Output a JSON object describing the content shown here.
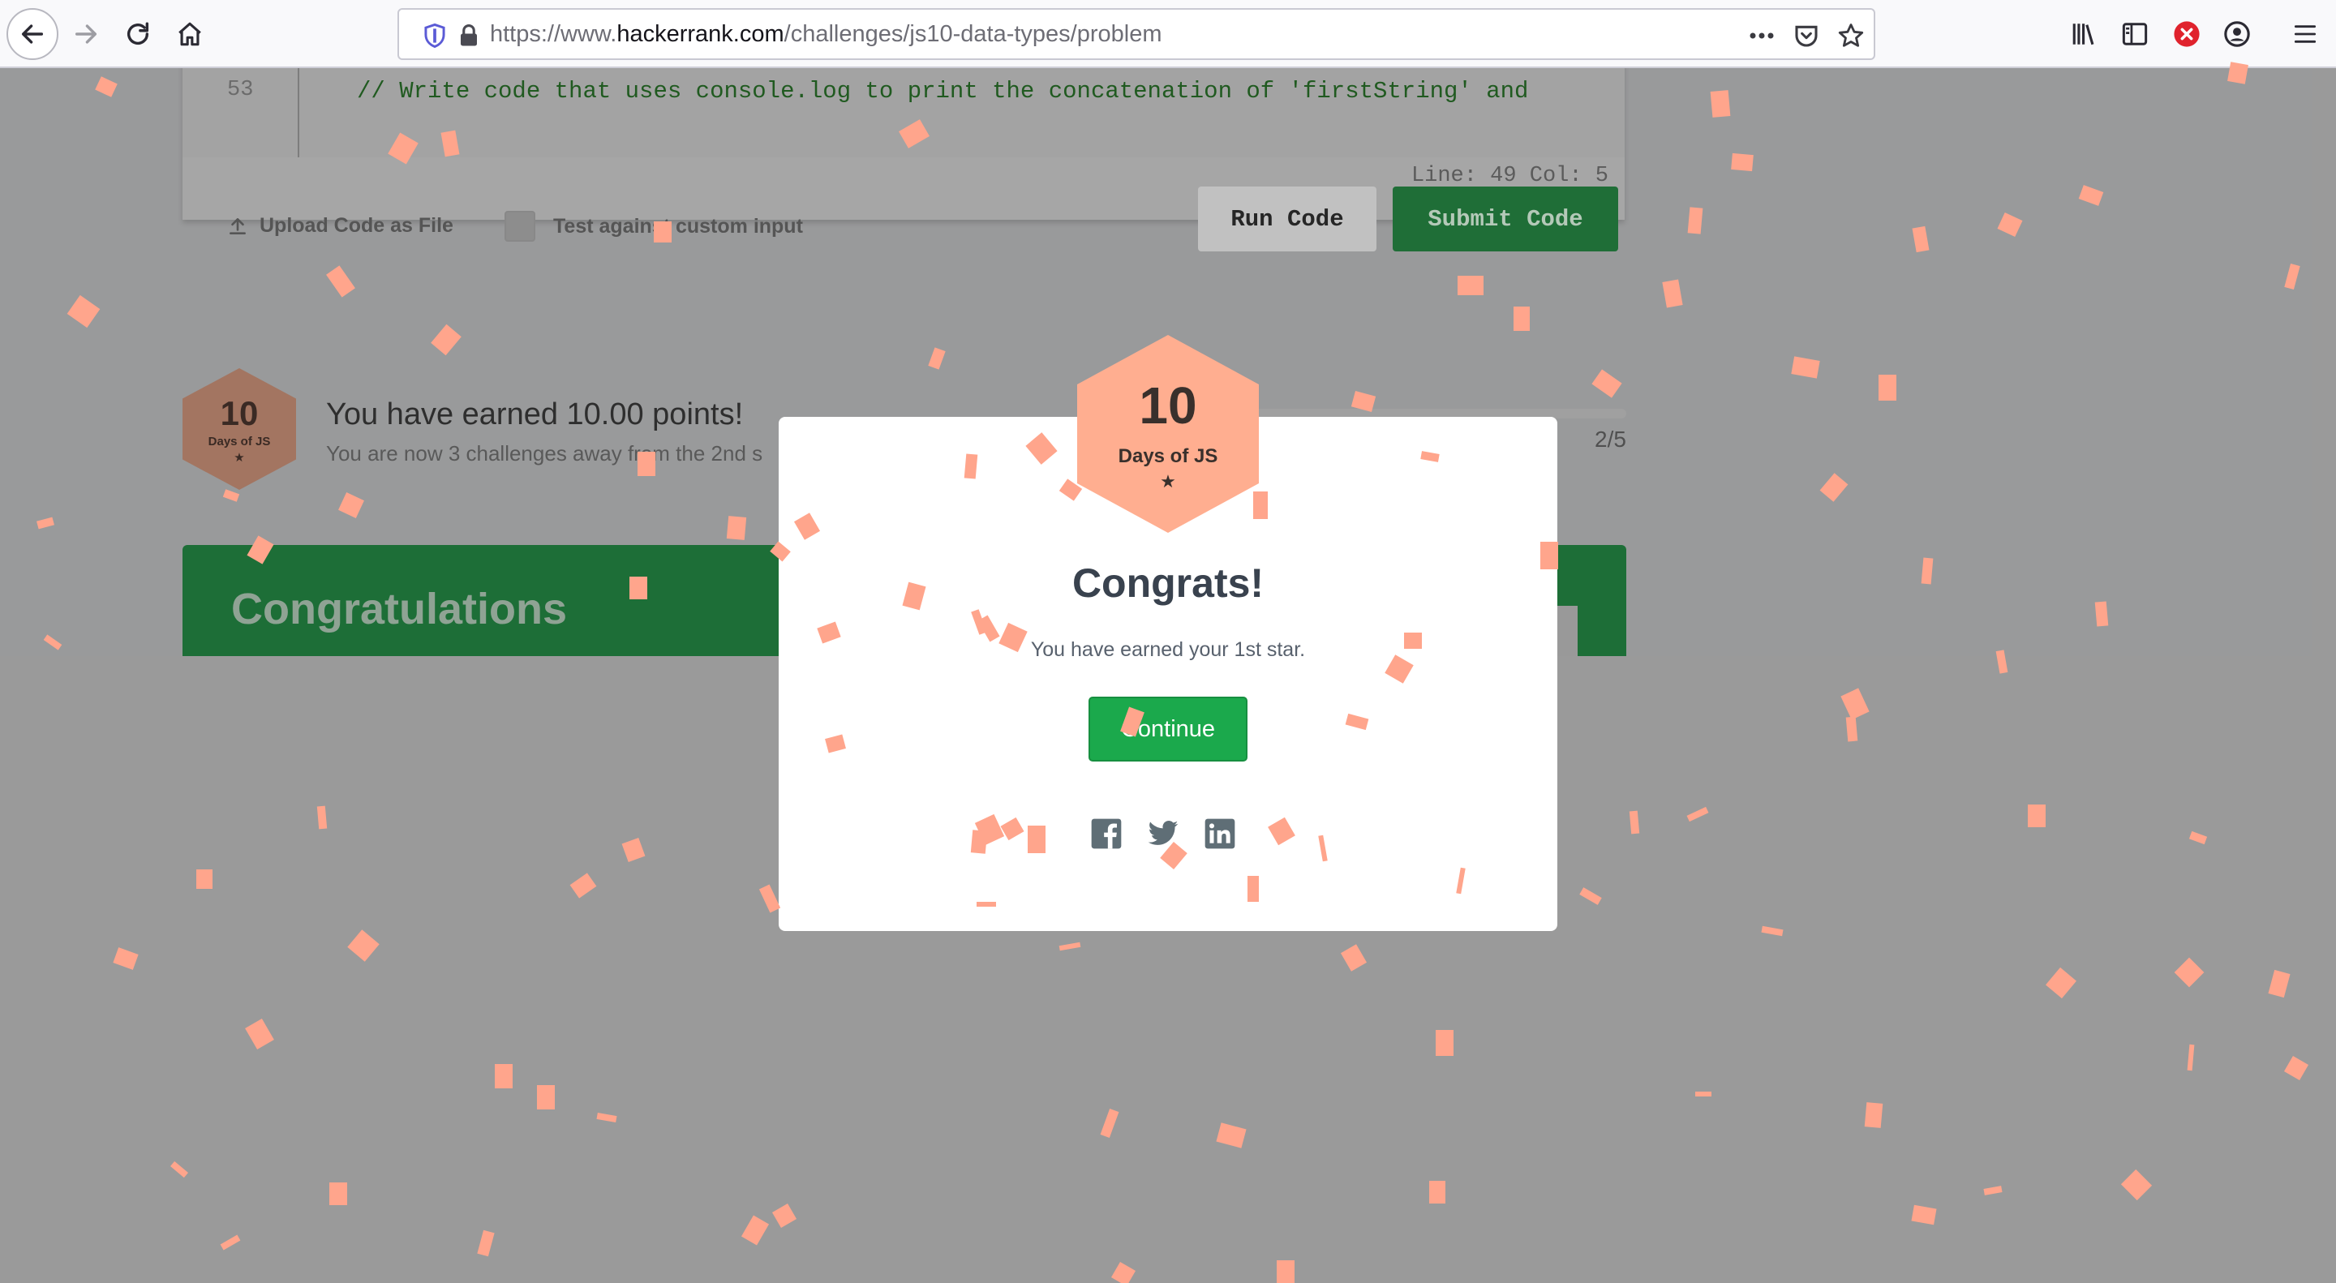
{
  "browser": {
    "url_prefix": "https://www.",
    "url_domain": "hackerrank.com",
    "url_path": "/challenges/js10-data-types/problem",
    "toolbar_icons": [
      "back-icon",
      "forward-icon",
      "reload-icon",
      "home-icon",
      "shield-icon",
      "lock-icon",
      "more-icon",
      "pocket-icon",
      "star-icon",
      "library-icon",
      "sidebar-icon",
      "blocked-icon",
      "account-icon",
      "menu-icon"
    ]
  },
  "editor": {
    "line_number": "53",
    "code_line": "// Write code that uses console.log to print the concatenation of 'firstString' and",
    "status": "Line: 49 Col: 5"
  },
  "actions": {
    "upload_label_a": "Upload",
    "upload_label_b": "Code as File",
    "custom_input_label": "Test against custom input",
    "run_label": "Run Code",
    "submit_label": "Submit Code"
  },
  "achievement": {
    "badge_number": "10",
    "badge_name": "Days of JS",
    "badge_stars": "★",
    "earned_text": "You have earned 10.00 points!",
    "earned_subtext": "You are now 3 challenges away from the 2nd s",
    "progress_count": "2/5",
    "progress_fraction": 0.4
  },
  "banner": {
    "title": "Congratulations"
  },
  "modal": {
    "badge_number": "10",
    "badge_name": "Days of JS",
    "badge_stars": "★",
    "title": "Congrats!",
    "subtitle": "You have earned your 1st star.",
    "continue_label": "Continue",
    "share_icons": [
      "facebook-icon",
      "twitter-icon",
      "linkedin-icon"
    ]
  },
  "colors": {
    "overlay": "#9a9a9a",
    "confetti": "#ffa58c",
    "success_green": "#1ba94c",
    "badge_bronze": "#ffae90"
  }
}
